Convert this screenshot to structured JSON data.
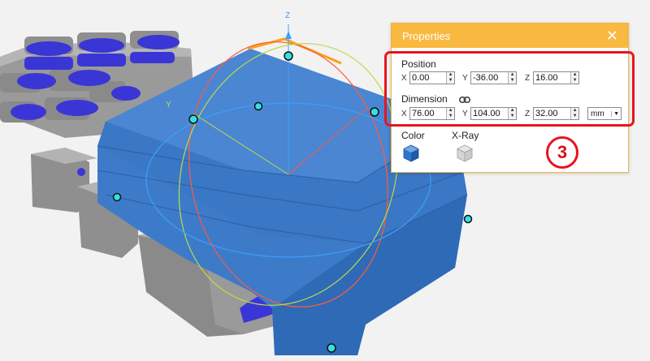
{
  "viewport": {
    "axis_z_label": "Z",
    "axis_y_label": "Y",
    "colors": {
      "background": "#f2f2f2",
      "selected_model": "#3d7bc9",
      "gray_part": "#9a9a9a",
      "purple_pin": "#3a36d6",
      "handle": "#33e0e6",
      "axis_z": "#3aa0ff",
      "axis_x": "#ff5a3c",
      "axis_y": "#b8dc4a"
    }
  },
  "properties": {
    "title": "Properties",
    "close_icon": "close-icon",
    "position": {
      "label": "Position",
      "x_label": "X",
      "x_value": "0.00",
      "y_label": "Y",
      "y_value": "-36.00",
      "z_label": "Z",
      "z_value": "16.00"
    },
    "dimension": {
      "label": "Dimension",
      "lock_icon": "link-icon",
      "x_label": "X",
      "x_value": "76.00",
      "y_label": "Y",
      "y_value": "104.00",
      "z_label": "Z",
      "z_value": "32.00",
      "unit": "mm"
    },
    "color_label": "Color",
    "xray_label": "X-Ray"
  },
  "annotation": {
    "number": "3",
    "color": "#e8141e"
  }
}
